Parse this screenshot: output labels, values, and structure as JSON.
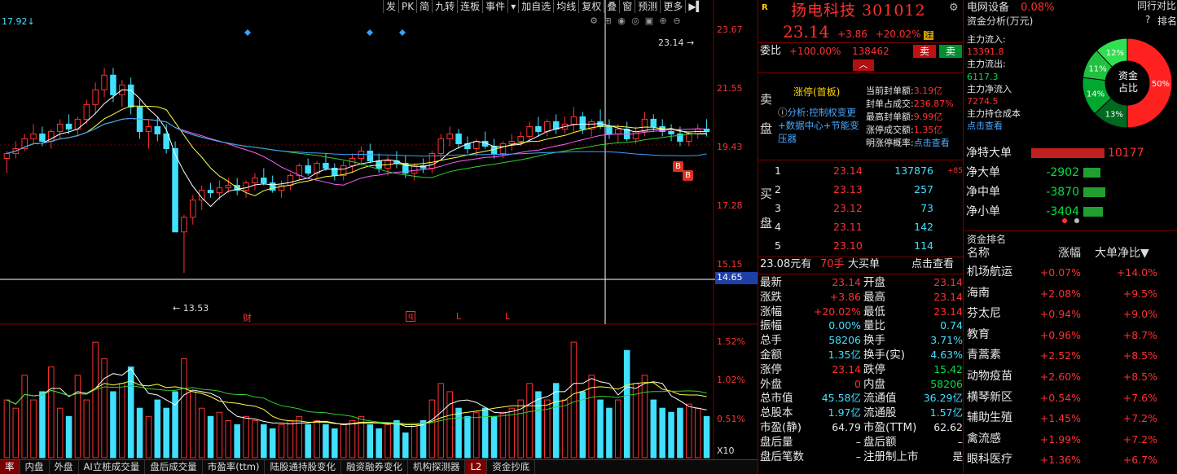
{
  "stock": {
    "name": "扬电科技",
    "code": "301012",
    "price": "23.14",
    "change": "+3.86",
    "change_pct": "+20.02%",
    "flag": "注",
    "r_badge": "R"
  },
  "toolbar": [
    "发",
    "PK",
    "简",
    "九转",
    "连板",
    "事件",
    "加自选",
    "均线",
    "复权",
    "叠",
    "窗",
    "预测",
    "更多"
  ],
  "chart": {
    "top_left": "17.92",
    "price_labels": [
      "23.67",
      "21.55",
      "19.43",
      "17.28",
      "15.15"
    ],
    "current_price_tag": "14.65",
    "high_marker": "23.14",
    "low_marker": "13.53",
    "event_marks": [
      "财",
      "q",
      "L",
      "L"
    ],
    "buy_marks": [
      "B",
      "B"
    ],
    "volume_labels": [
      "1.52%",
      "1.02%",
      "0.51%"
    ],
    "volume_unit": "X10",
    "colors": {
      "up": "#ff3030",
      "down": "#40e0ff",
      "ma5": "#ffffff",
      "ma10": "#ffff40",
      "ma20": "#ff60ff",
      "ma30": "#30d030",
      "ma60": "#40a0ff"
    }
  },
  "chart_data": {
    "type": "candlestick",
    "ylim": [
      13.53,
      23.67
    ],
    "candles": [
      [
        18.2,
        18.5,
        17.6,
        18.4
      ],
      [
        18.4,
        18.9,
        18.2,
        18.6
      ],
      [
        18.6,
        19.2,
        18.5,
        19.0
      ],
      [
        19.0,
        19.6,
        18.8,
        19.2
      ],
      [
        19.2,
        19.5,
        18.7,
        18.9
      ],
      [
        18.9,
        19.4,
        18.6,
        19.3
      ],
      [
        19.3,
        19.8,
        19.0,
        19.6
      ],
      [
        19.6,
        20.0,
        19.2,
        19.4
      ],
      [
        19.4,
        19.9,
        19.1,
        19.8
      ],
      [
        19.8,
        20.6,
        19.6,
        20.4
      ],
      [
        20.4,
        21.3,
        20.0,
        21.0
      ],
      [
        21.0,
        21.9,
        20.7,
        21.6
      ],
      [
        21.6,
        21.9,
        20.5,
        20.8
      ],
      [
        20.8,
        21.4,
        20.3,
        21.2
      ],
      [
        21.2,
        21.5,
        20.0,
        20.3
      ],
      [
        20.3,
        20.6,
        19.0,
        19.3
      ],
      [
        19.3,
        19.8,
        18.6,
        19.5
      ],
      [
        19.5,
        19.9,
        18.9,
        19.2
      ],
      [
        19.2,
        19.6,
        18.4,
        18.6
      ],
      [
        18.6,
        18.9,
        17.5,
        15.2
      ],
      [
        15.2,
        15.9,
        13.53,
        15.8
      ],
      [
        15.8,
        16.7,
        15.5,
        16.5
      ],
      [
        16.5,
        17.1,
        16.1,
        16.9
      ],
      [
        16.9,
        17.2,
        16.6,
        16.8
      ],
      [
        16.8,
        17.3,
        16.5,
        17.0
      ],
      [
        17.0,
        17.4,
        16.8,
        17.1
      ],
      [
        17.1,
        17.4,
        16.7,
        16.9
      ],
      [
        16.9,
        17.3,
        16.6,
        17.2
      ],
      [
        17.2,
        17.6,
        16.9,
        17.4
      ],
      [
        17.4,
        17.8,
        17.1,
        17.2
      ],
      [
        17.2,
        17.5,
        16.8,
        16.9
      ],
      [
        16.9,
        17.3,
        16.6,
        17.1
      ],
      [
        17.1,
        17.6,
        16.9,
        17.5
      ],
      [
        17.5,
        18.0,
        17.3,
        17.9
      ],
      [
        17.9,
        18.2,
        17.5,
        17.6
      ],
      [
        17.6,
        18.1,
        17.4,
        18.0
      ],
      [
        18.0,
        18.4,
        17.7,
        17.8
      ],
      [
        17.8,
        18.0,
        17.3,
        17.5
      ],
      [
        17.5,
        18.1,
        17.3,
        17.9
      ],
      [
        17.9,
        18.4,
        17.6,
        18.2
      ],
      [
        18.2,
        18.7,
        17.9,
        18.5
      ],
      [
        18.5,
        18.8,
        18.0,
        18.1
      ],
      [
        18.1,
        18.4,
        17.6,
        17.8
      ],
      [
        17.8,
        18.3,
        17.5,
        18.1
      ],
      [
        18.1,
        18.5,
        17.8,
        18.0
      ],
      [
        18.0,
        18.3,
        17.4,
        17.6
      ],
      [
        17.6,
        18.0,
        17.3,
        17.9
      ],
      [
        17.9,
        18.2,
        17.6,
        17.8
      ],
      [
        17.8,
        18.5,
        17.6,
        18.4
      ],
      [
        18.4,
        19.2,
        18.2,
        19.0
      ],
      [
        19.0,
        19.5,
        18.7,
        19.2
      ],
      [
        19.2,
        19.4,
        18.6,
        18.8
      ],
      [
        18.8,
        19.1,
        18.4,
        18.6
      ],
      [
        18.6,
        19.0,
        18.3,
        18.9
      ],
      [
        18.9,
        19.3,
        18.6,
        18.7
      ],
      [
        18.7,
        19.0,
        18.2,
        18.4
      ],
      [
        18.4,
        18.9,
        18.2,
        18.8
      ],
      [
        18.8,
        19.2,
        18.5,
        18.9
      ],
      [
        18.9,
        19.3,
        18.7,
        19.1
      ],
      [
        19.1,
        19.7,
        18.9,
        19.5
      ],
      [
        19.5,
        19.9,
        19.1,
        19.3
      ],
      [
        19.3,
        19.8,
        19.1,
        19.7
      ],
      [
        19.7,
        20.0,
        19.2,
        19.4
      ],
      [
        19.4,
        19.9,
        19.2,
        19.6
      ],
      [
        19.6,
        20.3,
        19.3,
        19.9
      ],
      [
        19.9,
        20.1,
        19.2,
        19.4
      ],
      [
        19.4,
        19.8,
        19.1,
        19.7
      ],
      [
        19.7,
        20.2,
        19.4,
        19.5
      ],
      [
        19.5,
        19.8,
        19.0,
        19.2
      ],
      [
        19.2,
        19.6,
        18.8,
        19.4
      ],
      [
        19.4,
        19.7,
        18.9,
        19.0
      ],
      [
        19.0,
        19.5,
        18.8,
        19.3
      ],
      [
        19.3,
        20.1,
        19.1,
        19.8
      ],
      [
        19.8,
        20.0,
        19.3,
        19.5
      ],
      [
        19.5,
        19.8,
        19.1,
        19.3
      ],
      [
        19.3,
        19.6,
        18.9,
        19.2
      ],
      [
        19.2,
        19.5,
        18.7,
        18.9
      ],
      [
        18.9,
        19.3,
        18.7,
        19.2
      ],
      [
        19.2,
        19.6,
        19.0,
        19.4
      ],
      [
        19.4,
        19.8,
        19.1,
        19.3
      ]
    ],
    "volume": [
      0.7,
      0.6,
      1.0,
      0.7,
      0.8,
      1.1,
      0.6,
      0.5,
      1.0,
      0.7,
      1.4,
      1.2,
      0.8,
      0.9,
      1.1,
      0.6,
      0.5,
      0.7,
      0.6,
      0.8,
      1.2,
      0.8,
      0.6,
      0.5,
      0.55,
      0.45,
      0.4,
      0.5,
      0.45,
      0.4,
      0.35,
      0.4,
      0.45,
      0.5,
      0.4,
      0.45,
      0.4,
      0.35,
      0.4,
      0.45,
      0.5,
      0.4,
      0.35,
      0.4,
      0.45,
      0.3,
      0.4,
      0.45,
      0.7,
      0.9,
      0.8,
      0.6,
      0.5,
      0.55,
      0.6,
      0.5,
      0.55,
      0.6,
      0.7,
      0.9,
      0.8,
      0.7,
      0.9,
      0.7,
      1.4,
      0.8,
      1.0,
      0.7,
      0.6,
      0.7,
      1.3,
      0.9,
      1.0,
      0.7,
      0.6,
      0.55,
      0.6,
      0.65,
      0.6,
      0.5
    ],
    "volume_ylim": [
      0,
      1.52
    ]
  },
  "order_book": {
    "ratio_label": "委比",
    "ratio_val": "+100.00%",
    "ratio_qty": "138462",
    "sell_btn": "卖",
    "buy_btn": "卖",
    "sell_side_label": "卖盘",
    "limit_title": "涨停(首板)",
    "analysis": "分析:控制权变更+数据中心+节能变压器",
    "limit_info": [
      {
        "k": "当前封单额:",
        "v": "3.19亿"
      },
      {
        "k": "封单占成交:",
        "v": "236.87%"
      },
      {
        "k": "最高封单额:",
        "v": "9.99亿"
      },
      {
        "k": "涨停成交额:",
        "v": "1.35亿"
      },
      {
        "k": "明涨停概率:",
        "v": "点击查看"
      }
    ],
    "buy_side_label": "买盘",
    "bids": [
      {
        "lvl": "1",
        "price": "23.14",
        "qty": "137876",
        "chg": "+85"
      },
      {
        "lvl": "2",
        "price": "23.13",
        "qty": "257",
        "chg": ""
      },
      {
        "lvl": "3",
        "price": "23.12",
        "qty": "73",
        "chg": ""
      },
      {
        "lvl": "4",
        "price": "23.11",
        "qty": "142",
        "chg": ""
      },
      {
        "lvl": "5",
        "price": "23.10",
        "qty": "114",
        "chg": ""
      }
    ],
    "big_order": {
      "price": "23.08元有",
      "hands": "70手",
      "label": "大买单",
      "link": "点击查看"
    }
  },
  "stats": [
    {
      "k1": "最新",
      "v1": "23.14",
      "c1": "red",
      "k2": "开盘",
      "v2": "23.14",
      "c2": "red"
    },
    {
      "k1": "涨跌",
      "v1": "+3.86",
      "c1": "red",
      "k2": "最高",
      "v2": "23.14",
      "c2": "red"
    },
    {
      "k1": "涨幅",
      "v1": "+20.02%",
      "c1": "red",
      "k2": "最低",
      "v2": "23.14",
      "c2": "red"
    },
    {
      "k1": "振幅",
      "v1": "0.00%",
      "c1": "cyan",
      "k2": "量比",
      "v2": "0.74",
      "c2": "cyan"
    },
    {
      "k1": "总手",
      "v1": "58206",
      "c1": "cyan",
      "k2": "换手",
      "v2": "3.71%",
      "c2": "cyan"
    },
    {
      "k1": "金额",
      "v1": "1.35亿",
      "c1": "cyan",
      "k2": "换手(实)",
      "v2": "4.63%",
      "c2": "cyan"
    },
    {
      "k1": "涨停",
      "v1": "23.14",
      "c1": "red",
      "k2": "跌停",
      "v2": "15.42",
      "c2": "green"
    },
    {
      "k1": "外盘",
      "v1": "0",
      "c1": "red",
      "k2": "内盘",
      "v2": "58206",
      "c2": "green"
    },
    {
      "k1": "总市值",
      "v1": "45.58亿",
      "c1": "cyan",
      "k2": "流通值",
      "v2": "36.29亿",
      "c2": "cyan"
    },
    {
      "k1": "总股本",
      "v1": "1.97亿",
      "c1": "cyan",
      "k2": "流通股",
      "v2": "1.57亿",
      "c2": "cyan"
    },
    {
      "k1": "市盈(静)",
      "v1": "64.79",
      "c1": "white",
      "k2": "市盈(TTM)",
      "v2": "62.62",
      "c2": "white"
    },
    {
      "k1": "盘后量",
      "v1": "–",
      "c1": "white",
      "k2": "盘后额",
      "v2": "–",
      "c2": "white"
    },
    {
      "k1": "盘后笔数",
      "v1": "–",
      "c1": "white",
      "k2": "注册制上市",
      "v2": "是",
      "c2": "white"
    }
  ],
  "sector": {
    "name": "电网设备",
    "pct": "0.08%",
    "compare": "同行对比"
  },
  "fund": {
    "title": "资金分析(万元)",
    "help": "?",
    "rank_btn": "排名",
    "inflow_label": "主力流入:",
    "inflow": "13391.8",
    "outflow_label": "主力流出:",
    "outflow": "6117.3",
    "net_label": "主力净流入",
    "net": "7274.5",
    "hold_label": "主力持仓成本",
    "hold_link": "点击查看",
    "donut_center": [
      "资金",
      "占比"
    ],
    "slices": [
      {
        "label": "50%",
        "v": 50,
        "color": "#ff2020"
      },
      {
        "label": "13%",
        "v": 13,
        "color": "#006a20"
      },
      {
        "label": "14%",
        "v": 14,
        "color": "#00a830"
      },
      {
        "label": "11%",
        "v": 11,
        "color": "#20c040"
      },
      {
        "label": "12%",
        "v": 12,
        "color": "#30e050"
      }
    ]
  },
  "flows": [
    {
      "label": "净特大单",
      "val": "10177",
      "frac": 0.9,
      "color": "#c02020"
    },
    {
      "label": "净大单",
      "val": "-2902",
      "frac": 0.3,
      "color": "#20a030"
    },
    {
      "label": "净中单",
      "val": "-3870",
      "frac": 0.38,
      "color": "#20a030"
    },
    {
      "label": "净小单",
      "val": "-3404",
      "frac": 0.34,
      "color": "#20a030"
    }
  ],
  "ranking": {
    "title": "资金排名",
    "h_name": "名称",
    "h_pct": "涨幅",
    "h_net": "大单净比",
    "rows": [
      {
        "n": "机场航运",
        "a": "+0.07%",
        "b": "+14.0%"
      },
      {
        "n": "海南",
        "a": "+2.08%",
        "b": "+9.5%"
      },
      {
        "n": "芬太尼",
        "a": "+0.94%",
        "b": "+9.0%"
      },
      {
        "n": "教育",
        "a": "+0.96%",
        "b": "+8.7%"
      },
      {
        "n": "青蒿素",
        "a": "+2.52%",
        "b": "+8.5%"
      },
      {
        "n": "动物疫苗",
        "a": "+2.60%",
        "b": "+8.5%"
      },
      {
        "n": "横琴新区",
        "a": "+0.54%",
        "b": "+7.6%"
      },
      {
        "n": "辅助生殖",
        "a": "+1.45%",
        "b": "+7.2%"
      },
      {
        "n": "禽流感",
        "a": "+1.99%",
        "b": "+7.2%"
      },
      {
        "n": "眼科医疗",
        "a": "+1.36%",
        "b": "+6.7%"
      }
    ]
  },
  "bottom_tabs": [
    "率",
    "内盘",
    "外盘",
    "AI立桩成交量",
    "盘后成交量",
    "市盈率(ttm)",
    "陆股通持股变化",
    "融资融券变化",
    "机构探测器",
    "L2",
    "资金抄底"
  ]
}
